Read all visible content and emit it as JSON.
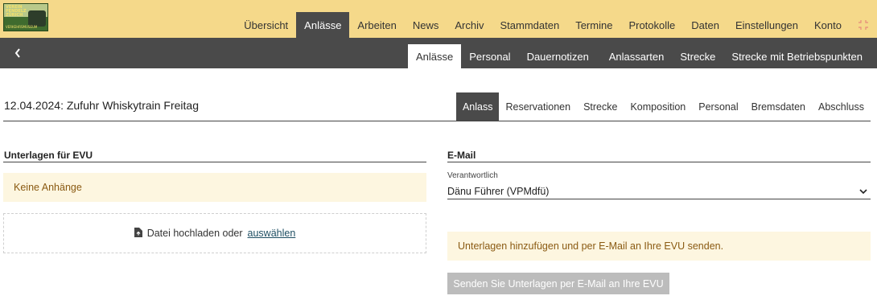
{
  "logo": {
    "lines": [
      "VEREIN",
      "PENDELZ",
      "ZÜRICH"
    ],
    "subtitle": "VERKEHRSMUSEUM",
    "alt": "verein-logo"
  },
  "main_nav": {
    "items": [
      {
        "label": "Übersicht",
        "active": false
      },
      {
        "label": "Anlässe",
        "active": true
      },
      {
        "label": "Arbeiten",
        "active": false
      },
      {
        "label": "News",
        "active": false
      },
      {
        "label": "Archiv",
        "active": false
      },
      {
        "label": "Stammdaten",
        "active": false
      },
      {
        "label": "Termine",
        "active": false
      },
      {
        "label": "Protokolle",
        "active": false
      },
      {
        "label": "Daten",
        "active": false
      },
      {
        "label": "Einstellungen",
        "active": false
      },
      {
        "label": "Konto",
        "active": false
      }
    ],
    "expand_icon": "expand-icon"
  },
  "sub_nav": {
    "back_icon": "chevron-left-icon",
    "left_items": [
      {
        "label": "Anlässe",
        "active": true
      },
      {
        "label": "Personal",
        "active": false
      },
      {
        "label": "Dauernotizen",
        "active": false
      }
    ],
    "right_items": [
      {
        "label": "Anlassarten"
      },
      {
        "label": "Strecke"
      },
      {
        "label": "Strecke mit Betriebspunkten"
      }
    ]
  },
  "page": {
    "title": "12.04.2024: Zufuhr Whiskytrain Freitag",
    "tabs": [
      {
        "label": "Anlass",
        "active": true
      },
      {
        "label": "Reservationen",
        "active": false
      },
      {
        "label": "Strecke",
        "active": false
      },
      {
        "label": "Komposition",
        "active": false
      },
      {
        "label": "Personal",
        "active": false
      },
      {
        "label": "Bremsdaten",
        "active": false
      },
      {
        "label": "Abschluss",
        "active": false
      }
    ]
  },
  "left": {
    "section_title": "Unterlagen für EVU",
    "empty_notice": "Keine Anhänge",
    "upload": {
      "icon": "file-upload-icon",
      "text": "Datei hochladen oder",
      "link": "auswählen"
    }
  },
  "right": {
    "section_title": "E-Mail",
    "responsible_label": "Verantwortlich",
    "responsible_value": "Dänu Führer (VPMdfü)",
    "notice": "Unterlagen hinzufügen und per E-Mail an Ihre EVU senden.",
    "send_button": "Senden Sie Unterlagen per E-Mail an Ihre EVU"
  },
  "colors": {
    "accent_bar": "#f5d98a",
    "dark_bar": "#4a4a4a",
    "notice_bg": "#fdf6e0",
    "notice_text": "#8a5a12",
    "disabled_button": "#bcbcbc"
  }
}
